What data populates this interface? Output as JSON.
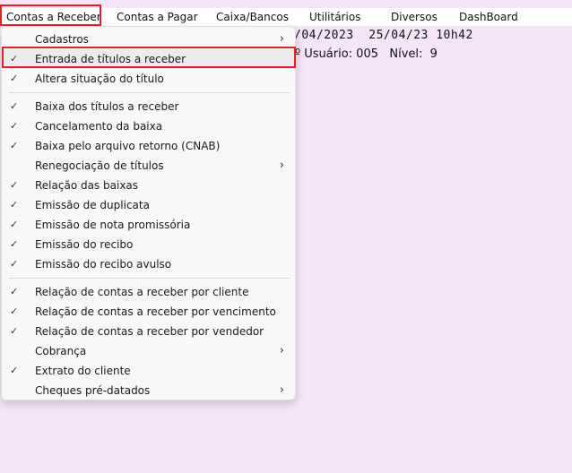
{
  "menubar": {
    "items": [
      {
        "label": "Contas a Receber"
      },
      {
        "label": "Contas a Pagar"
      },
      {
        "label": "Caixa/Bancos"
      },
      {
        "label": "Utilitários"
      },
      {
        "label": "Diversos"
      },
      {
        "label": "DashBoard"
      }
    ]
  },
  "terminal": {
    "line1": "/04/2023  25/04/23 10h42",
    "line2": "º Usuário: 005   Nível:  9"
  },
  "dropdown": {
    "items": [
      {
        "label": "Cadastros",
        "checked": false,
        "submenu": true
      },
      {
        "label": "Entrada de títulos a receber",
        "checked": true,
        "submenu": false
      },
      {
        "label": "Altera situação do título",
        "checked": true,
        "submenu": false
      },
      {
        "label": "Baixa dos títulos a receber",
        "checked": true,
        "submenu": false
      },
      {
        "label": "Cancelamento da baixa",
        "checked": true,
        "submenu": false
      },
      {
        "label": "Baixa pelo arquivo retorno (CNAB)",
        "checked": true,
        "submenu": false
      },
      {
        "label": "Renegociação de títulos",
        "checked": false,
        "submenu": true
      },
      {
        "label": "Relação das baixas",
        "checked": true,
        "submenu": false
      },
      {
        "label": "Emissão de duplicata",
        "checked": true,
        "submenu": false
      },
      {
        "label": "Emissão de nota promissória",
        "checked": true,
        "submenu": false
      },
      {
        "label": "Emissão do recibo",
        "checked": true,
        "submenu": false
      },
      {
        "label": "Emissão do recibo avulso",
        "checked": true,
        "submenu": false
      },
      {
        "label": "Relação de contas a receber por cliente",
        "checked": true,
        "submenu": false
      },
      {
        "label": "Relação de contas a receber por vencimento",
        "checked": true,
        "submenu": false
      },
      {
        "label": "Relação de contas a receber por vendedor",
        "checked": true,
        "submenu": false
      },
      {
        "label": "Cobrança",
        "checked": false,
        "submenu": true
      },
      {
        "label": "Extrato do cliente",
        "checked": true,
        "submenu": false
      },
      {
        "label": "Cheques pré-datados",
        "checked": false,
        "submenu": true
      }
    ],
    "check_glyph": "✓",
    "arrow_glyph": "›"
  },
  "colors": {
    "background": "#f4e6f8",
    "highlight_border": "#e3212b"
  }
}
